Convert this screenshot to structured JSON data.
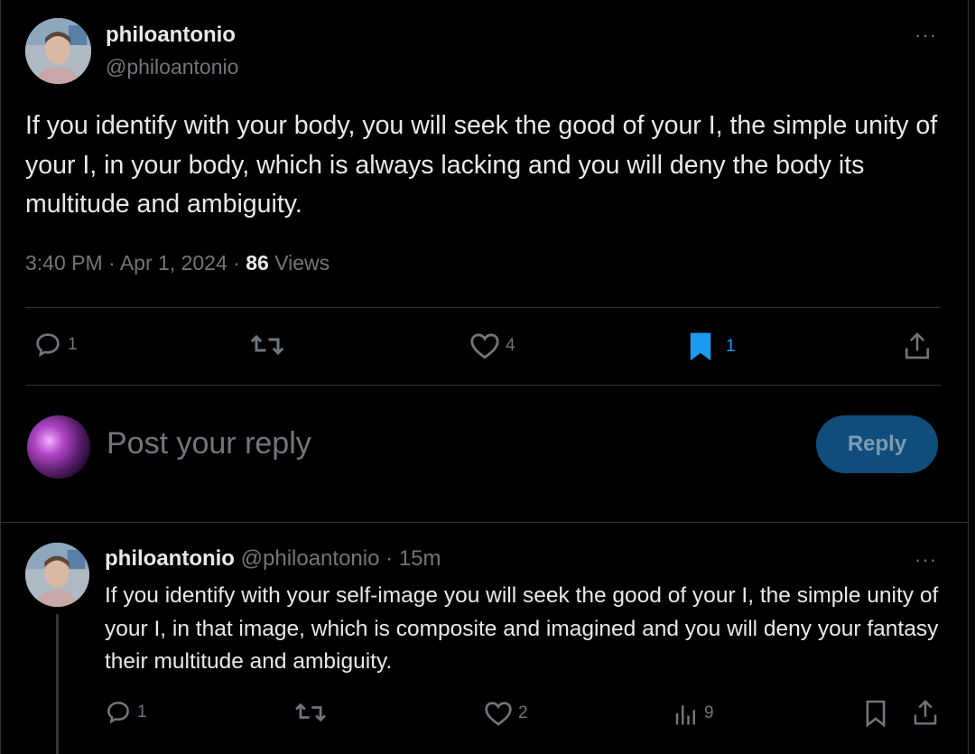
{
  "post": {
    "author": {
      "display_name": "philoantonio",
      "handle": "@philoantonio",
      "avatar_icon": "profile-photo"
    },
    "more_label": "···",
    "text": "If you identify with your body, you will seek the good of your I, the simple unity of your I, in your body, which is always lacking and you will deny the body its multitude and ambiguity.",
    "time": "3:40 PM",
    "sep1": "·",
    "date": "Apr 1, 2024",
    "sep2": "·",
    "views_count": "86",
    "views_label": "Views",
    "actions": {
      "reply_count": "1",
      "repost_count": "",
      "like_count": "4",
      "bookmark_count": "1"
    },
    "icons": {
      "reply": "comment-icon",
      "repost": "repost-icon",
      "like": "heart-icon",
      "bookmark": "bookmark-filled-icon",
      "share": "share-icon"
    },
    "bookmark_color": "#1d9bf0"
  },
  "composer": {
    "placeholder": "Post your reply",
    "button_label": "Reply",
    "button_color": "#0f4e7c"
  },
  "reply": {
    "display_name": "philoantonio",
    "handle": "@philoantonio",
    "sep": "·",
    "time_ago": "15m",
    "more_label": "···",
    "text": "If you identify with your self-image you will seek the good of your I, the simple unity of your I, in that image, which is composite and imagined and you will deny your fantasy their multitude and ambiguity.",
    "actions": {
      "reply_count": "1",
      "like_count": "2",
      "views_count": "9"
    }
  }
}
